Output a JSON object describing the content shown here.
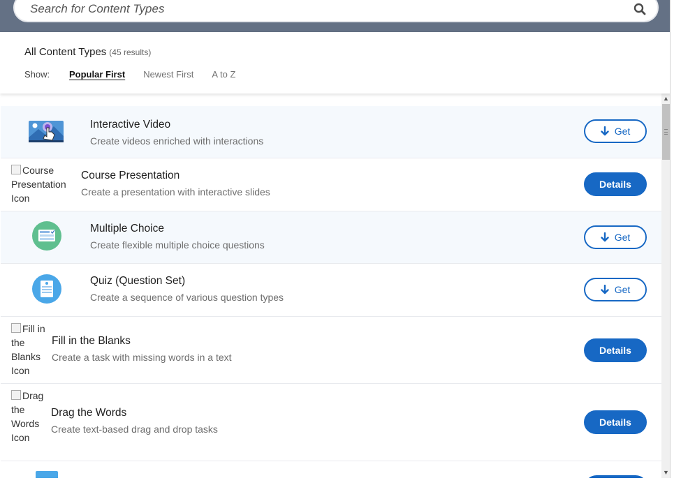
{
  "search": {
    "placeholder": "Search for Content Types",
    "icon": "search-icon"
  },
  "panel": {
    "title": "All Content Types",
    "count": "(45 results)",
    "show_label": "Show:",
    "sort_options": [
      {
        "label": "Popular First",
        "active": true
      },
      {
        "label": "Newest First",
        "active": false
      },
      {
        "label": "A to Z",
        "active": false
      }
    ]
  },
  "items": [
    {
      "title": "Interactive Video",
      "description": "Create videos enriched with interactions",
      "button": "Get",
      "icon": "interactive-video-icon",
      "icon_alt": ""
    },
    {
      "title": "Course Presentation",
      "description": "Create a presentation with interactive slides",
      "button": "Details",
      "icon": "broken-image",
      "icon_alt": "Course Presentation Icon"
    },
    {
      "title": "Multiple Choice",
      "description": "Create flexible multiple choice questions",
      "button": "Get",
      "icon": "multiple-choice-icon",
      "icon_alt": ""
    },
    {
      "title": "Quiz (Question Set)",
      "description": "Create a sequence of various question types",
      "button": "Get",
      "icon": "question-set-icon",
      "icon_alt": ""
    },
    {
      "title": "Fill in the Blanks",
      "description": "Create a task with missing words in a text",
      "button": "Details",
      "icon": "broken-image",
      "icon_alt": "Fill in the Blanks Icon"
    },
    {
      "title": "Drag the Words",
      "description": "Create text-based drag and drop tasks",
      "button": "Details",
      "icon": "broken-image",
      "icon_alt": "Drag the Words Icon"
    }
  ],
  "colors": {
    "header_bg": "#647185",
    "accent": "#1768c4",
    "row_alt_bg": "#f5f9fd"
  }
}
